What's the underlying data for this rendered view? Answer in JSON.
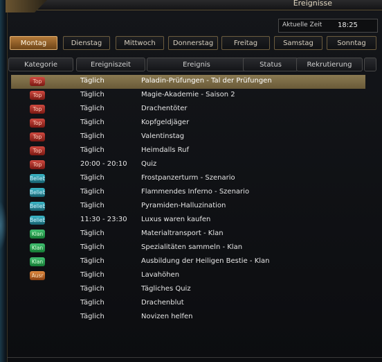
{
  "window": {
    "title": "Ereignisse"
  },
  "clock": {
    "label": "Aktuelle Zeit",
    "value": "18:25"
  },
  "days": [
    {
      "label": "Montag",
      "active": true
    },
    {
      "label": "Dienstag",
      "active": false
    },
    {
      "label": "Mittwoch",
      "active": false
    },
    {
      "label": "Donnerstag",
      "active": false
    },
    {
      "label": "Freitag",
      "active": false
    },
    {
      "label": "Samstag",
      "active": false
    },
    {
      "label": "Sonntag",
      "active": false
    }
  ],
  "columns": [
    "Kategorie",
    "Ereigniszeit",
    "Ereignis",
    "Status",
    "Rekrutierung"
  ],
  "events": [
    {
      "badge": "Top",
      "badge_type": "top",
      "time": "Täglich",
      "name": "Paladin-Prüfungen - Tal der Prüfungen",
      "selected": true
    },
    {
      "badge": "Top",
      "badge_type": "top",
      "time": "Täglich",
      "name": "Magie-Akademie - Saison 2",
      "selected": false
    },
    {
      "badge": "Top",
      "badge_type": "top",
      "time": "Täglich",
      "name": "Drachentöter",
      "selected": false
    },
    {
      "badge": "Top",
      "badge_type": "top",
      "time": "Täglich",
      "name": "Kopfgeldjäger",
      "selected": false
    },
    {
      "badge": "Top",
      "badge_type": "top",
      "time": "Täglich",
      "name": "Valentinstag",
      "selected": false
    },
    {
      "badge": "Top",
      "badge_type": "top",
      "time": "Täglich",
      "name": "Heimdalls Ruf",
      "selected": false
    },
    {
      "badge": "Top",
      "badge_type": "top",
      "time": "20:00 - 20:10",
      "name": "Quiz",
      "selected": false
    },
    {
      "badge": "Beliebt",
      "badge_type": "beliebt",
      "time": "Täglich",
      "name": "Frostpanzerturm - Szenario",
      "selected": false
    },
    {
      "badge": "Beliebt",
      "badge_type": "beliebt",
      "time": "Täglich",
      "name": "Flammendes Inferno - Szenario",
      "selected": false
    },
    {
      "badge": "Beliebt",
      "badge_type": "beliebt",
      "time": "Täglich",
      "name": "Pyramiden-Halluzination",
      "selected": false
    },
    {
      "badge": "Beliebt",
      "badge_type": "beliebt",
      "time": "11:30 - 23:30",
      "name": "Luxus waren kaufen",
      "selected": false
    },
    {
      "badge": "Klan",
      "badge_type": "klan",
      "time": "Täglich",
      "name": "Materialtransport - Klan",
      "selected": false
    },
    {
      "badge": "Klan",
      "badge_type": "klan",
      "time": "Täglich",
      "name": "Spezialitäten sammeln - Klan",
      "selected": false
    },
    {
      "badge": "Klan",
      "badge_type": "klan",
      "time": "Täglich",
      "name": "Ausbildung der Heiligen Bestie - Klan",
      "selected": false
    },
    {
      "badge": "Ausr",
      "badge_type": "ausr",
      "time": "Täglich",
      "name": "Lavahöhen",
      "selected": false
    },
    {
      "badge": "",
      "badge_type": "",
      "time": "Täglich",
      "name": "Tägliches Quiz",
      "selected": false
    },
    {
      "badge": "",
      "badge_type": "",
      "time": "Täglich",
      "name": "Drachenblut",
      "selected": false
    },
    {
      "badge": "",
      "badge_type": "",
      "time": "Täglich",
      "name": "Novizen helfen",
      "selected": false
    }
  ]
}
